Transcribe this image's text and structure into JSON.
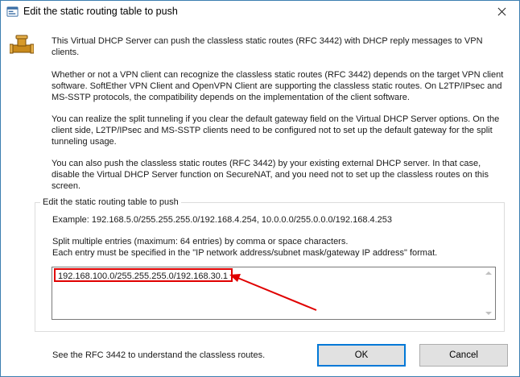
{
  "window": {
    "title": "Edit the static routing table to push"
  },
  "intro": {
    "p1": "This Virtual DHCP Server can push the classless static routes (RFC 3442) with DHCP reply messages to VPN clients.",
    "p2": "Whether or not a VPN client can recognize the classless static routes (RFC 3442) depends on the target VPN client software. SoftEther VPN Client and OpenVPN Client are supporting the classless static routes. On L2TP/IPsec and MS-SSTP protocols, the compatibility depends on the implementation of the client software.",
    "p3": "You can realize the split tunneling if you clear the default gateway field on the Virtual DHCP Server options. On the client side, L2TP/IPsec and MS-SSTP clients need to be configured not to set up the default gateway for the split tunneling usage.",
    "p4": "You can also push the classless static routes (RFC 3442) by your existing external DHCP server. In that case, disable the Virtual DHCP Server function on SecureNAT, and you need not to set up the classless routes on this screen."
  },
  "group": {
    "label": "Edit the static routing table to push",
    "example": "Example: 192.168.5.0/255.255.255.0/192.168.4.254, 10.0.0.0/255.0.0.0/192.168.4.253",
    "help_line1": "Split multiple entries (maximum: 64 entries) by comma or space characters.",
    "help_line2": "Each entry must be specified in the \"IP network address/subnet mask/gateway IP address\" format.",
    "routes_value": "192.168.100.0/255.255.255.0/192.168.30.1"
  },
  "footer": {
    "rfc_note": "See the RFC 3442 to understand the classless routes.",
    "ok_label": "OK",
    "cancel_label": "Cancel"
  },
  "colors": {
    "annotation": "#e00000",
    "focus_border": "#0078d7"
  },
  "icons": {
    "title": "app-icon",
    "header": "pipe-icon",
    "close": "close-icon"
  }
}
